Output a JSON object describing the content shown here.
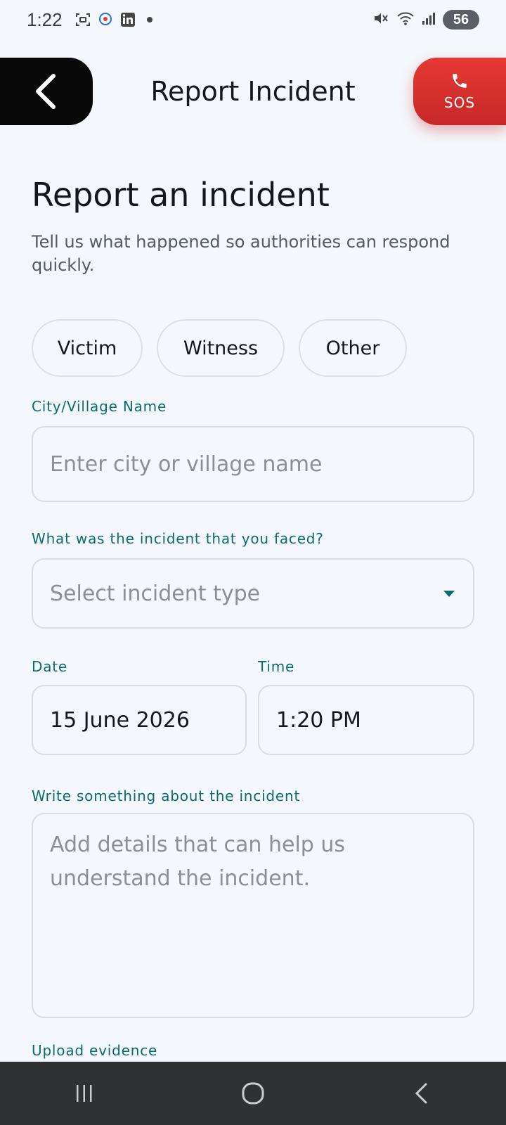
{
  "status_bar": {
    "time": "1:22",
    "battery": "56"
  },
  "header": {
    "title": "Report Incident",
    "sos_label": "SOS"
  },
  "main": {
    "heading": "Report an incident",
    "subtext": "Tell us what happened so authorities can respond quickly.",
    "roles": [
      "Victim",
      "Witness",
      "Other"
    ],
    "city": {
      "label": "City/Village Name",
      "placeholder": "Enter city or village name"
    },
    "incident": {
      "label": "What was the incident that you faced?",
      "placeholder": "Select incident type"
    },
    "date": {
      "label": "Date",
      "value": "15 June 2026"
    },
    "time": {
      "label": "Time",
      "value": "1:20 PM"
    },
    "details": {
      "label": "Write something about the incident",
      "placeholder": "Add details that can help us understand the incident."
    },
    "upload": {
      "label": "Upload evidence"
    }
  },
  "colors": {
    "accent": "#0b6b72",
    "sos": "#d32f2f",
    "background": "#f4f7fb"
  }
}
